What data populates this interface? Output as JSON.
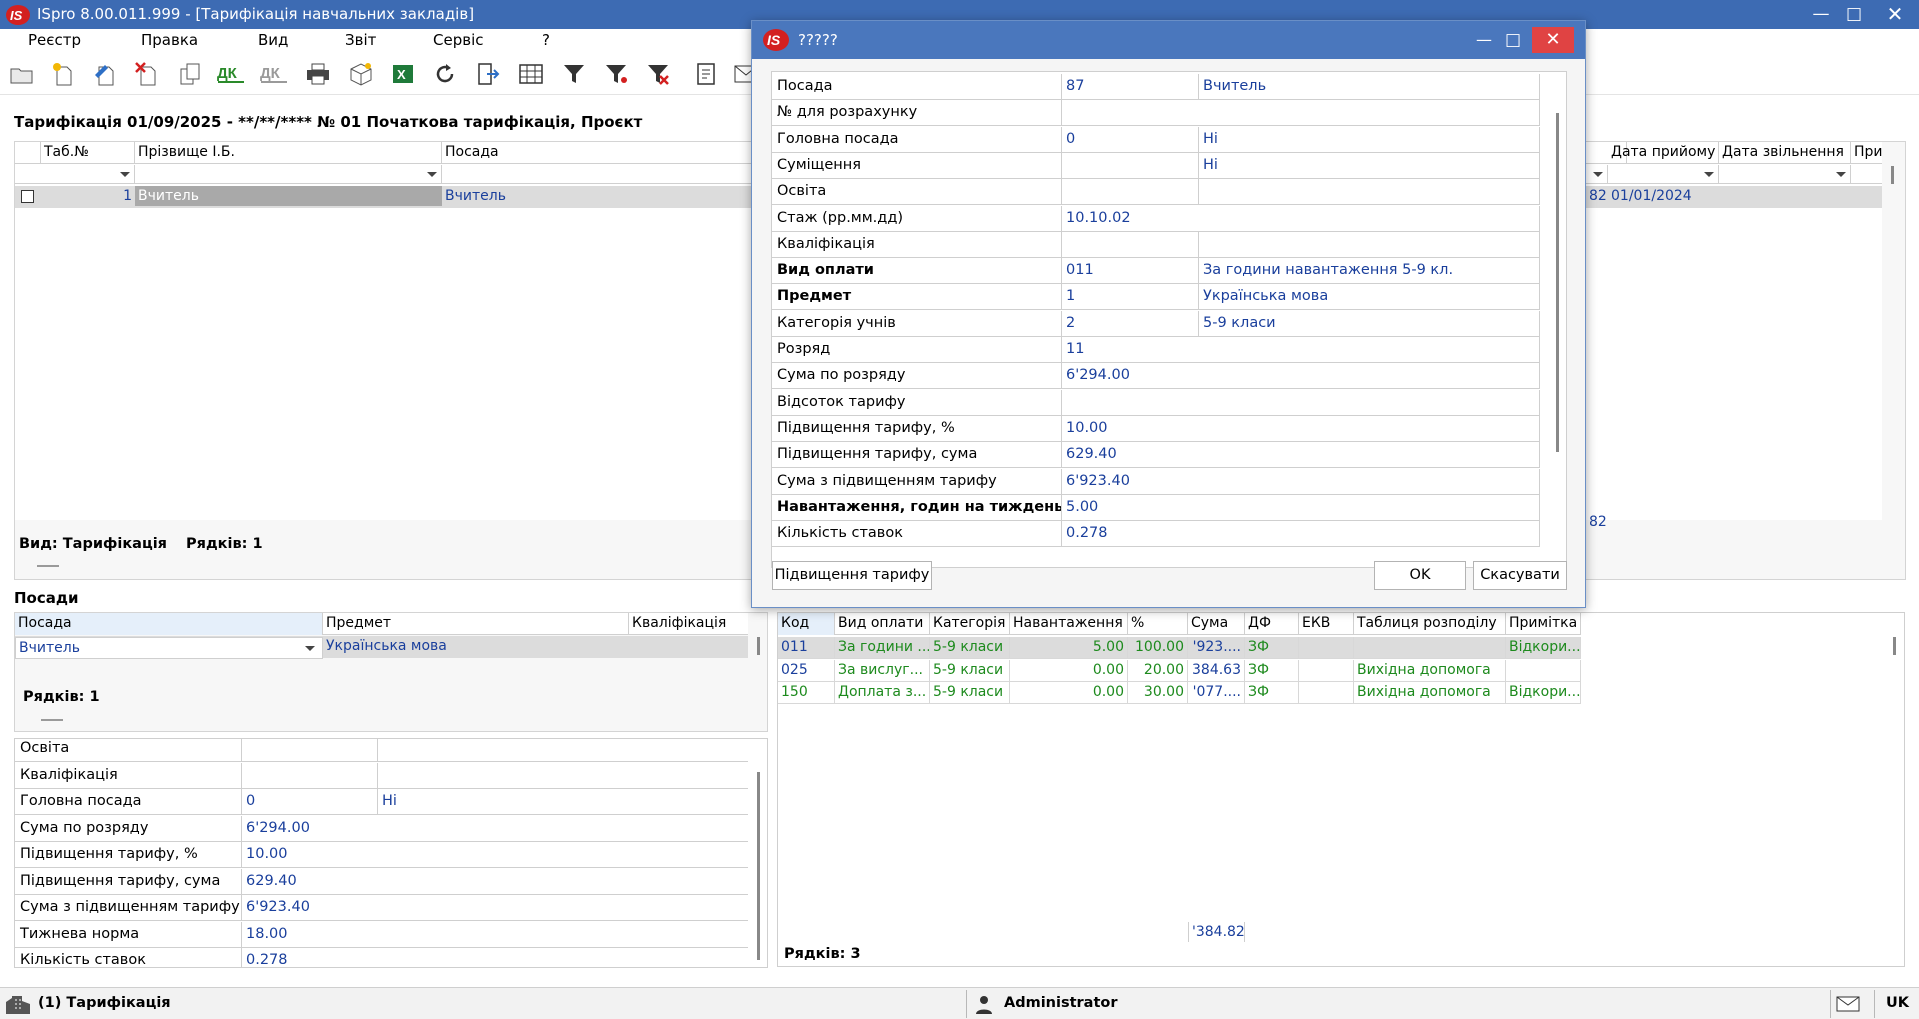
{
  "app": {
    "title": "ISpro 8.00.011.999 - [Тарифікація навчальних закладів]",
    "colors": {
      "titlebar": "#3d6bb3",
      "value_blue": "#1a3f9c",
      "value_green": "#1d8a1d",
      "close_red": "#e04343"
    }
  },
  "menu": [
    "Реєстр",
    "Правка",
    "Вид",
    "Звіт",
    "Сервіс",
    "?"
  ],
  "toolbar": {
    "icons": [
      "open-folder-icon",
      "new-document-icon",
      "edit-document-icon",
      "delete-document-icon",
      "copy-icon",
      "dk-icon",
      "dk-disabled-icon",
      "print-icon",
      "package-icon",
      "excel-export-icon",
      "refresh-icon",
      "exit-icon",
      "table-view-icon",
      "filter-icon",
      "filter-add-icon",
      "filter-clear-icon",
      "card-icon",
      "mail-icon"
    ]
  },
  "main": {
    "header": "Тарифікація 01/09/2025 - **/**/**** № 01 Початкова тарифікація, Проєкт",
    "columns": [
      "Таб.№",
      "Прізвище І.Б.",
      "Посада"
    ],
    "columns_right": [
      "Дата прийому",
      "Дата звільнення",
      "При"
    ],
    "row": {
      "tab_no": "1",
      "name": "Вчитель",
      "position": "Вчитель",
      "partial": "82",
      "hire_date": "01/01/2024"
    },
    "footer_partial": "82",
    "footer_view_label": "Вид: Тарифікація",
    "footer_rows_label": "Рядків: 1"
  },
  "positions": {
    "title": "Посади",
    "columns": [
      "Посада",
      "Предмет",
      "Кваліфікація"
    ],
    "row": {
      "position": "Вчитель",
      "subject": "Українська мова",
      "qualification": ""
    },
    "rows_label": "Рядків: 1"
  },
  "details": {
    "rows": [
      {
        "label": "Освіта",
        "value": "",
        "value2": ""
      },
      {
        "label": "Кваліфікація",
        "value": "",
        "value2": ""
      },
      {
        "label": "Головна посада",
        "value": "0",
        "value2": "Ні"
      },
      {
        "label": "Сума по розряду",
        "value": "6'294.00"
      },
      {
        "label": "Підвищення тарифу, %",
        "value": "10.00"
      },
      {
        "label": "Підвищення тарифу, сума",
        "value": "629.40"
      },
      {
        "label": "Сума з підвищенням тарифу",
        "value": "6'923.40"
      },
      {
        "label": "Тижнева норма",
        "value": "18.00"
      },
      {
        "label": "Кількість ставок",
        "value": "0.278"
      }
    ]
  },
  "payments": {
    "columns": [
      "Код",
      "Вид оплати",
      "Категорія",
      "Навантаження",
      "%",
      "Сума",
      "ДФ",
      "ЕКВ",
      "Таблиця розподілу",
      "Примітка"
    ],
    "rows": [
      {
        "code": "011",
        "type": "За години ...",
        "category": "5-9 класи",
        "load": "5.00",
        "pct": "100.00",
        "sum": "'923....",
        "df": "ЗФ",
        "ekv": "",
        "table": "",
        "note": "Відкори..."
      },
      {
        "code": "025",
        "type": "За вислуг...",
        "category": "5-9 класи",
        "load": "0.00",
        "pct": "20.00",
        "sum": "384.63",
        "df": "ЗФ",
        "ekv": "",
        "table": "Вихідна допомога",
        "note": ""
      },
      {
        "code": "150",
        "type": "Доплата з...",
        "category": "5-9 класи",
        "load": "0.00",
        "pct": "30.00",
        "sum": "'077....",
        "df": "ЗФ",
        "ekv": "",
        "table": "Вихідна допомога",
        "note": "Відкори..."
      }
    ],
    "total_sum": "'384.82",
    "rows_label": "Рядків: 3"
  },
  "dialog": {
    "title": "?????",
    "fields": [
      {
        "label": "Посада",
        "code": "87",
        "value": "Вчитель",
        "bold": false,
        "split": true
      },
      {
        "label": "№ для розрахунку",
        "code": "",
        "value": "",
        "bold": false,
        "split": false
      },
      {
        "label": "Головна посада",
        "code": "0",
        "value": "Ні",
        "bold": false,
        "split": true
      },
      {
        "label": "Суміщення",
        "code": "",
        "value": "Ні",
        "bold": false,
        "split": true
      },
      {
        "label": "Освіта",
        "code": "",
        "value": "",
        "bold": false,
        "split": true
      },
      {
        "label": "Стаж (рр.мм.дд)",
        "code": "10.10.02",
        "value": "",
        "bold": false,
        "split": false
      },
      {
        "label": "Кваліфікація",
        "code": "",
        "value": "",
        "bold": false,
        "split": true
      },
      {
        "label": "Вид оплати",
        "code": "011",
        "value": "За години навантаження 5-9 кл.",
        "bold": true,
        "split": true
      },
      {
        "label": "Предмет",
        "code": "1",
        "value": "Українська мова",
        "bold": true,
        "split": true
      },
      {
        "label": "Категорія учнів",
        "code": "2",
        "value": "5-9 класи",
        "bold": false,
        "split": true
      },
      {
        "label": "Розряд",
        "code": "11",
        "value": "",
        "bold": false,
        "split": false
      },
      {
        "label": "Сума по розряду",
        "code": "6'294.00",
        "value": "",
        "bold": false,
        "split": false
      },
      {
        "label": "Відсоток тарифу",
        "code": "",
        "value": "",
        "bold": false,
        "split": false
      },
      {
        "label": "Підвищення тарифу, %",
        "code": "10.00",
        "value": "",
        "bold": false,
        "split": false
      },
      {
        "label": "Підвищення тарифу, сума",
        "code": "629.40",
        "value": "",
        "bold": false,
        "split": false
      },
      {
        "label": "Сума з підвищенням тарифу",
        "code": "6'923.40",
        "value": "",
        "bold": false,
        "split": false
      },
      {
        "label": "Навантаження, годин на тиждень",
        "code": "5.00",
        "value": "",
        "bold": true,
        "split": false
      },
      {
        "label": "Кількість ставок",
        "code": "0.278",
        "value": "",
        "bold": false,
        "split": false
      }
    ],
    "raise_button": "Підвищення тарифу",
    "ok_button": "OK",
    "cancel_button": "Скасувати"
  },
  "statusbar": {
    "tab": "(1) Тарифікація",
    "user": "Administrator",
    "lang": "UK"
  }
}
